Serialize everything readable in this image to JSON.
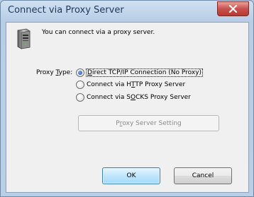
{
  "window": {
    "title": "Connect via Proxy Server"
  },
  "intro_text": "You can connect via a proxy server.",
  "proxy_type": {
    "label_pre": "Proxy ",
    "label_mnemonic": "T",
    "label_post": "ype:",
    "options": [
      {
        "pre": "",
        "mnemonic": "D",
        "post": "irect TCP/IP Connection (No Proxy)",
        "checked": true
      },
      {
        "pre": "Connect via H",
        "mnemonic": "T",
        "post": "TP Proxy Server",
        "checked": false
      },
      {
        "pre": "Connect via S",
        "mnemonic": "O",
        "post": "CKS Proxy Server",
        "checked": false
      }
    ]
  },
  "buttons": {
    "proxy_setting_pre": "P",
    "proxy_setting_mnemonic": "r",
    "proxy_setting_post": "oxy Server Setting",
    "ok": "OK",
    "cancel": "Cancel"
  },
  "colors": {
    "titlebar": "#b7cde6",
    "close": "#c75050",
    "dialog_bg": "#f0f0f0",
    "disabled_text": "#8a8a8a"
  }
}
